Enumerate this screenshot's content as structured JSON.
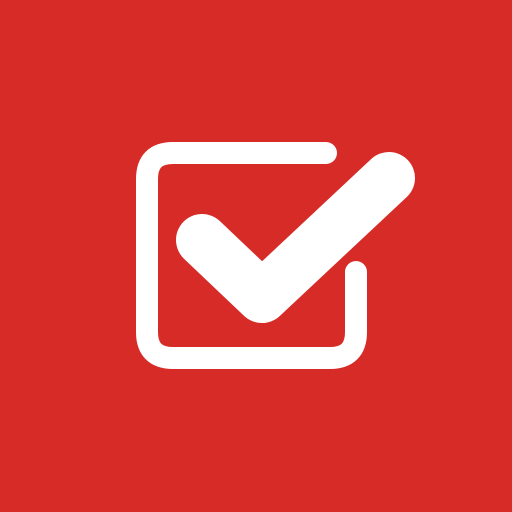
{
  "icon": {
    "name": "checked-checkbox-icon",
    "background_color": "#D72B27",
    "foreground_color": "#FFFFFF"
  }
}
